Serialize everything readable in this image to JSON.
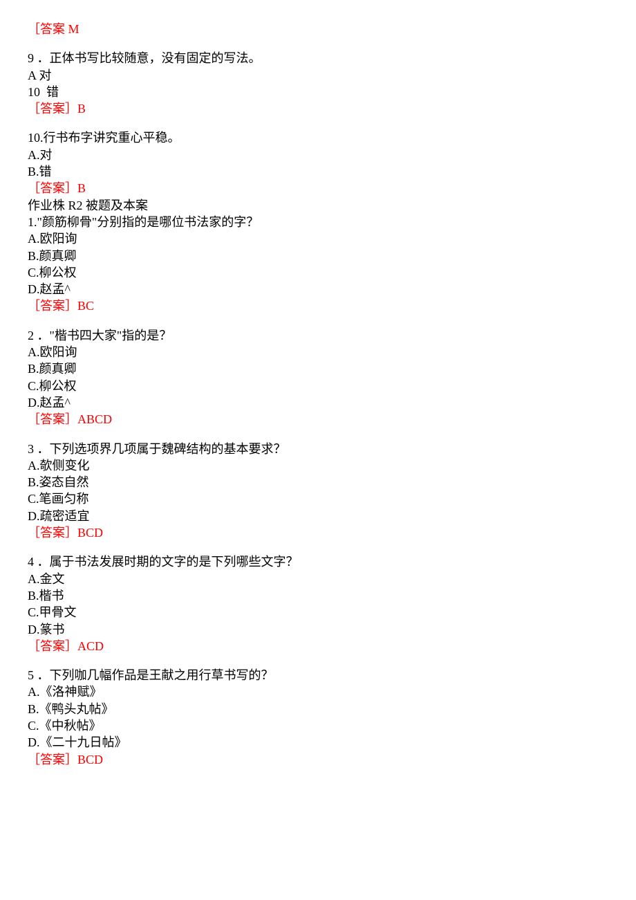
{
  "top_answer": "［答案 M",
  "q9": {
    "text": "9 ．正体书写比较随意，没有固定的写法。",
    "a": "A 对",
    "b": "10  错",
    "answer": "［答案］B"
  },
  "q10": {
    "text": "10.行书布字讲究重心平稳。",
    "a": "A.对",
    "b": "B.错",
    "answer": "［答案］B"
  },
  "section": "作业株 R2 被题及本案",
  "q1": {
    "text": "1.\"颜筋柳骨\"分别指的是哪位书法家的字？",
    "a": "A.欧阳询",
    "b": "B.颜真卿",
    "c": "C.柳公权",
    "d": "D.赵孟^",
    "answer": "［答案］BC"
  },
  "q2": {
    "text": "2 ．\"楷书四大家\"指的是？",
    "a": "A.欧阳询",
    "b": "B.颜真卿",
    "c": "C.柳公权",
    "d": "D.赵孟^",
    "answer": "［答案］ABCD"
  },
  "q3": {
    "text": "3 ．下列选项界几项属于魏碑结构的基本要求？",
    "a": "A.欹侧变化",
    "b": "B.姿态自然",
    "c": "C.笔画匀称",
    "d": "D.疏密适宜",
    "answer": "［答案］BCD"
  },
  "q4": {
    "text": "4 ．属于书法发展时期的文字的是下列哪些文字？",
    "a": "A.金文",
    "b": "B.楷书",
    "c": "C.甲骨文",
    "d": "D.篆书",
    "answer": "［答案］ACD"
  },
  "q5": {
    "text": "5 ．下列咖几幅作品是王献之用行草书写的？",
    "a": "A.《洛神赋》",
    "b": "B.《鸭头丸帖》",
    "c": "C.《中秋帖》",
    "d": "D.《二十九日帖》",
    "answer": "［答案］BCD"
  }
}
